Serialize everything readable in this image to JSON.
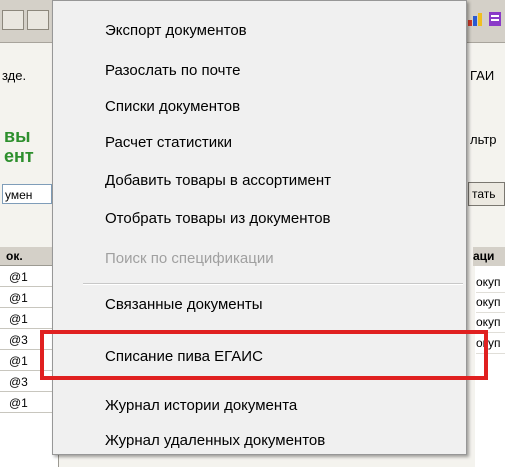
{
  "background": {
    "left_labels": {
      "section": "зде.",
      "title_line1": "вы",
      "title_line2": "ент",
      "combo": "умен"
    },
    "right_labels": {
      "tab": "ГАИ",
      "filter": "льтр",
      "button": "тать"
    },
    "left_column_header": "ок.",
    "left_rows": [
      "@1",
      "@1",
      "@1",
      "@3",
      "@1",
      "@3",
      "@1"
    ],
    "right_column_header": "аци",
    "right_rows": [
      "окуп",
      "окуп",
      "окуп",
      "окуп"
    ]
  },
  "context_menu": {
    "items": [
      {
        "label": "Экспорт документов",
        "enabled": true
      },
      {
        "label": "Разослать по почте",
        "enabled": true
      },
      {
        "label": "Списки документов",
        "enabled": true
      },
      {
        "label": "Расчет статистики",
        "enabled": true
      },
      {
        "label": "Добавить товары в ассортимент",
        "enabled": true
      },
      {
        "label": "Отобрать товары из документов",
        "enabled": true
      },
      {
        "label": "Поиск по спецификации",
        "enabled": false
      },
      {
        "label": "Связанные документы",
        "enabled": true
      },
      {
        "label": "Списание пива ЕГАИС",
        "enabled": true,
        "highlighted": true
      },
      {
        "label": "Журнал истории документа",
        "enabled": true
      },
      {
        "label": "Журнал удаленных документов",
        "enabled": true
      }
    ]
  },
  "colors": {
    "highlight_border": "#e02020",
    "title_green": "#2d8f2d",
    "menu_background": "#f0f0f0",
    "disabled_text": "#a0a0a0"
  }
}
